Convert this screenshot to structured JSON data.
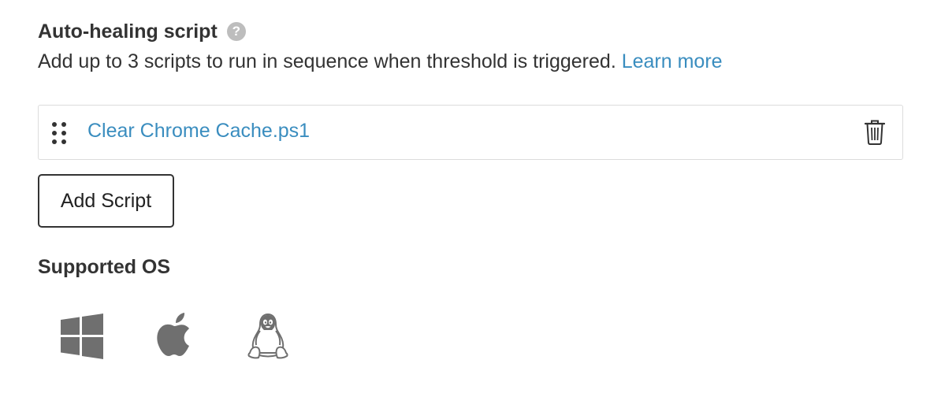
{
  "script_section": {
    "title": "Auto-healing script",
    "help_glyph": "?",
    "description": "Add up to 3 scripts to run in sequence when threshold is triggered.",
    "learn_more_label": "Learn more"
  },
  "scripts": [
    {
      "name": "Clear Chrome Cache.ps1"
    }
  ],
  "add_script_label": "Add Script",
  "supported_os": {
    "title": "Supported OS",
    "icons": [
      "windows-icon",
      "apple-icon",
      "linux-icon"
    ]
  },
  "colors": {
    "text": "#333333",
    "link": "#3a8dbf",
    "help_icon": "#bdbdbd",
    "os_icon": "#6f6f6f",
    "border": "#dcdcdc"
  }
}
